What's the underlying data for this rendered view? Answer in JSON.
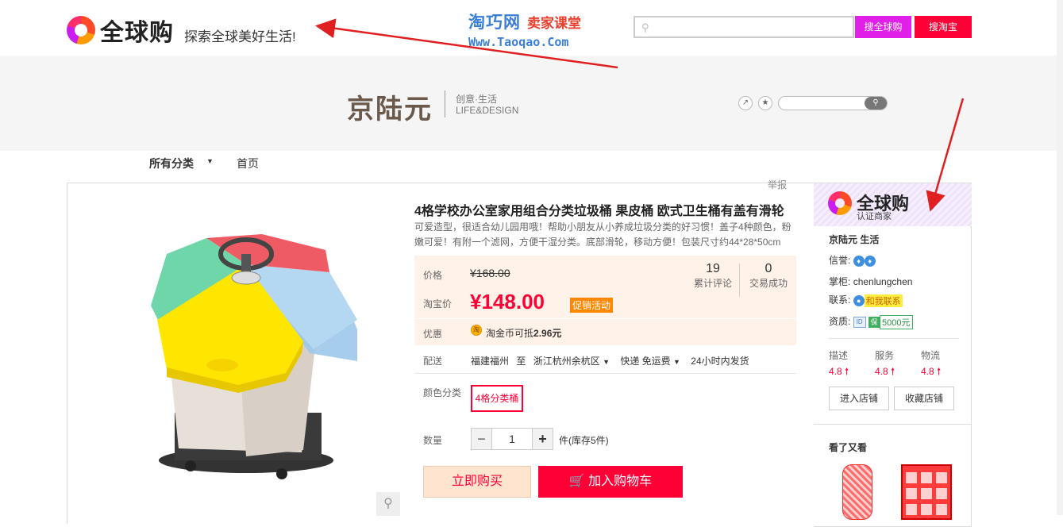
{
  "header": {
    "logo_text": "全球购",
    "slogan": "探索全球美好生活!",
    "watermark_cn": "淘巧网",
    "watermark_cn2": "卖家课堂",
    "watermark_url": "Www.Taoqao.Com",
    "search_icon": "search-icon",
    "btn_global": "搜全球购",
    "btn_taobao": "搜淘宝"
  },
  "store": {
    "name": "京陆元",
    "tag1": "创意·生活",
    "tag2": "LIFE&DESIGN"
  },
  "nav": {
    "all_categories": "所有分类",
    "home": "首页",
    "report": "举报"
  },
  "product": {
    "title": "4格学校办公室家用组合分类垃圾桶 果皮桶 欧式卫生桶有盖有滑轮",
    "subtitle": "可爱造型，很适合幼儿园用哦！帮助小朋友从小养成垃圾分类的好习惯！盖子4种颜色，粉嫩可爱！有附一个滤网，方便干湿分类。底部滑轮，移动方便！包装尺寸约44*28*50cm",
    "price_label": "价格",
    "orig_price": "¥168.00",
    "tb_price_label": "淘宝价",
    "now_price": "¥148.00",
    "promo": "促销活动",
    "reviews_count": "19",
    "reviews_label": "累计评论",
    "sales_count": "0",
    "sales_label": "交易成功",
    "discount_label": "优惠",
    "coin_text": "淘金币可抵",
    "coin_amount": "2.96元",
    "ship_label": "配送",
    "ship_from": "福建福州",
    "ship_to_word": "至",
    "ship_to": "浙江杭州余杭区",
    "ship_method": "快递 免运费",
    "ship_time": "24小时内发货",
    "color_label": "颜色分类",
    "color_option": "4格分类桶",
    "qty_label": "数量",
    "qty_value": "1",
    "stock": "件(库存5件)",
    "buy_now": "立即购买",
    "add_cart": "加入购物车"
  },
  "side": {
    "logo": "全球购",
    "logo_sub": "认证商家",
    "shop_name": "京陆元 生活",
    "credit_label": "信誉:",
    "keeper_label": "掌柜:",
    "keeper": "chenlungchen",
    "contact_label": "联系:",
    "contact_btn": "和我联系",
    "qual_label": "资质:",
    "deposit": "5000元",
    "rate_desc": "描述",
    "rate_desc_v": "4.8",
    "rate_service": "服务",
    "rate_service_v": "4.8",
    "rate_logistics": "物流",
    "rate_logistics_v": "4.8",
    "enter_store": "进入店铺",
    "fav_store": "收藏店铺",
    "see_also": "看了又看"
  },
  "colors": {
    "brand_red": "#ff0036",
    "global_purple": "#e020e8",
    "promo_orange": "#ff8800"
  }
}
